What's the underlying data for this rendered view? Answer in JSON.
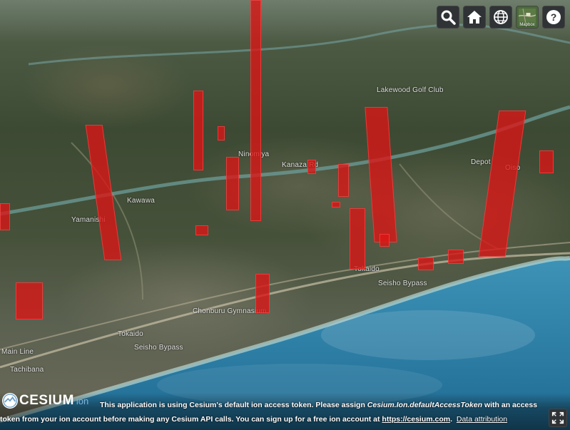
{
  "map_labels": [
    {
      "text": "Lakewood Golf Club"
    },
    {
      "text": "Kawawa"
    },
    {
      "text": "Yamanishi"
    },
    {
      "text": "Ninomiya"
    },
    {
      "text": "Kanaza Rd"
    },
    {
      "text": "Tokaido"
    },
    {
      "text": "Seisho Bypass"
    },
    {
      "text": "Seisho Bypass"
    },
    {
      "text": "Chonburu Gymnasium"
    },
    {
      "text": "Tokaido"
    },
    {
      "text": "Main Line"
    },
    {
      "text": "Tachibana"
    },
    {
      "text": "Oiso"
    },
    {
      "text": "Depot"
    }
  ],
  "toolbar": {
    "search_title": "Geocoder",
    "home_title": "Home",
    "scene_mode_title": "Scene mode",
    "basemap_label": "Mapbox",
    "help_title": "Help"
  },
  "logo": {
    "text": "CESIUM",
    "sub": "ion"
  },
  "token_message": {
    "part1": "This application is using Cesium's default ion access token. Please assign ",
    "code": "Cesium.Ion.defaultAccessToken",
    "part2": " with an access",
    "part3": "token from your ion account before making any Cesium API calls. You can sign up for a free ion account at ",
    "link": "https://cesium.com",
    "part4": ".",
    "attribution": "Data attribution"
  },
  "colors": {
    "bar": "#dc1414",
    "toolbar_bg": "#303336",
    "ocean": "#2e7fa6"
  }
}
